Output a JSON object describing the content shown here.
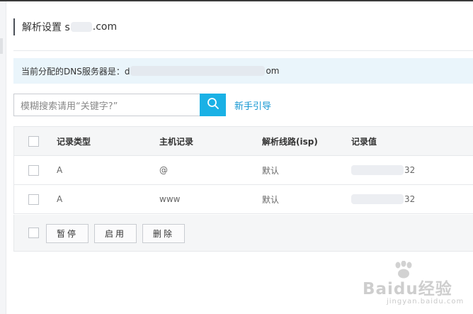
{
  "header": {
    "title_prefix": "解析设置 s",
    "title_suffix": ".com"
  },
  "notice": {
    "prefix": "当前分配的DNS服务器是：d",
    "suffix": "om"
  },
  "search": {
    "placeholder": "模糊搜索请用“关键字?”",
    "button_icon": "search-icon"
  },
  "guide_link": "新手引导",
  "table": {
    "headers": [
      "记录类型",
      "主机记录",
      "解析线路(isp)",
      "记录值"
    ],
    "rows": [
      {
        "type": "A",
        "host": "@",
        "line": "默认",
        "value_suffix": "32"
      },
      {
        "type": "A",
        "host": "www",
        "line": "默认",
        "value_suffix": "32"
      }
    ]
  },
  "actions": {
    "pause": "暂停",
    "enable": "启用",
    "delete": "删除"
  },
  "watermark": {
    "logo": "Baidu经验",
    "sub": "jingyan.baidu.com"
  },
  "colors": {
    "accent": "#1ab1e5",
    "link": "#1597d2",
    "notice_bg": "#eaf5fb"
  }
}
